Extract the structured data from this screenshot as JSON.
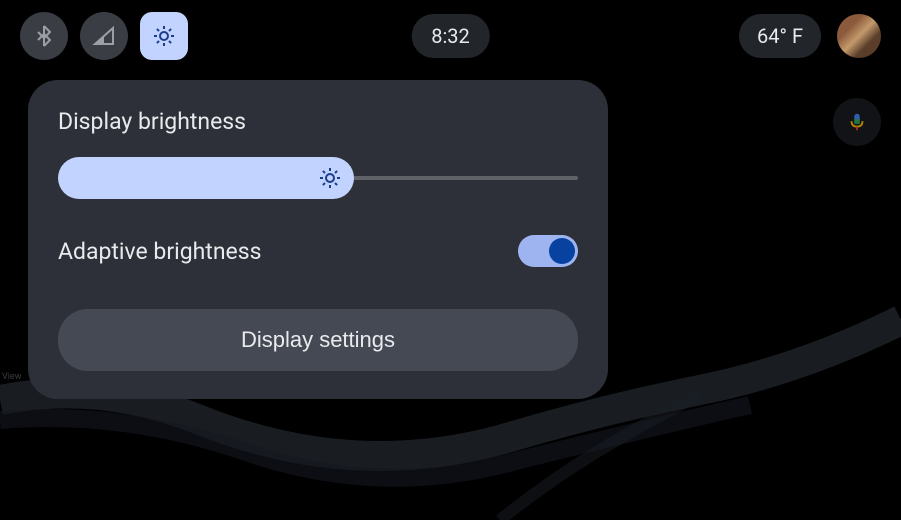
{
  "statusBar": {
    "time": "8:32",
    "temperature": "64° F"
  },
  "panel": {
    "title": "Display brightness",
    "brightnessPercent": 57,
    "adaptiveLabel": "Adaptive brightness",
    "adaptiveEnabled": true,
    "settingsButton": "Display settings"
  },
  "map": {
    "label": "View"
  }
}
